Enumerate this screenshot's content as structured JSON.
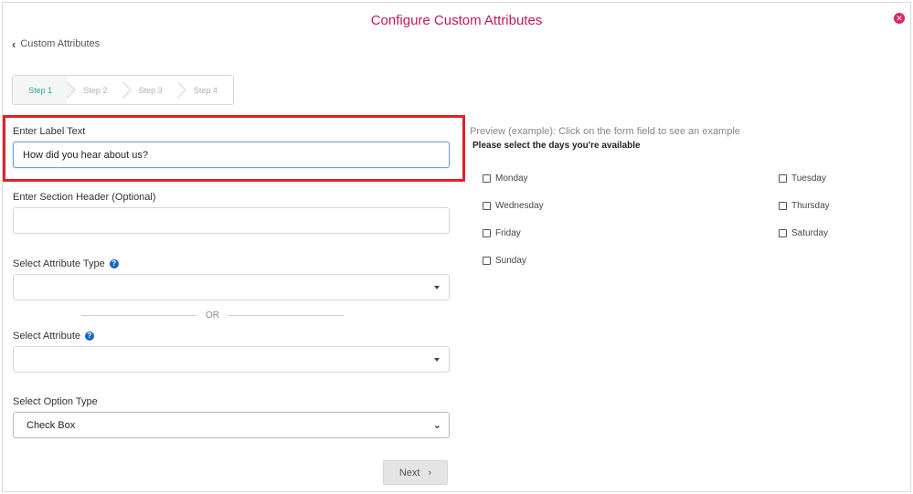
{
  "dialog": {
    "title": "Configure Custom Attributes",
    "back_label": "Custom Attributes"
  },
  "steps": [
    "Step 1",
    "Step 2",
    "Step 3",
    "Step 4"
  ],
  "active_step": 0,
  "form": {
    "label_text": {
      "label": "Enter Label Text",
      "value": "How did you hear about us?"
    },
    "section_header": {
      "label": "Enter Section Header (Optional)",
      "value": ""
    },
    "attribute_type": {
      "label": "Select Attribute Type",
      "value": ""
    },
    "or_text": "OR",
    "attribute": {
      "label": "Select Attribute",
      "value": ""
    },
    "option_type": {
      "label": "Select Option Type",
      "value": "Check Box"
    },
    "next_label": "Next"
  },
  "preview": {
    "caption": "Preview (example): Click on the form field to see an example",
    "question": "Please select the days you're available",
    "options": [
      "Monday",
      "Tuesday",
      "Wednesday",
      "Thursday",
      "Friday",
      "Saturday",
      "Sunday"
    ]
  },
  "colors": {
    "title": "#c2185b",
    "highlight": "#e02128",
    "active_step": "#2aa39a",
    "help_icon": "#1565c0"
  }
}
